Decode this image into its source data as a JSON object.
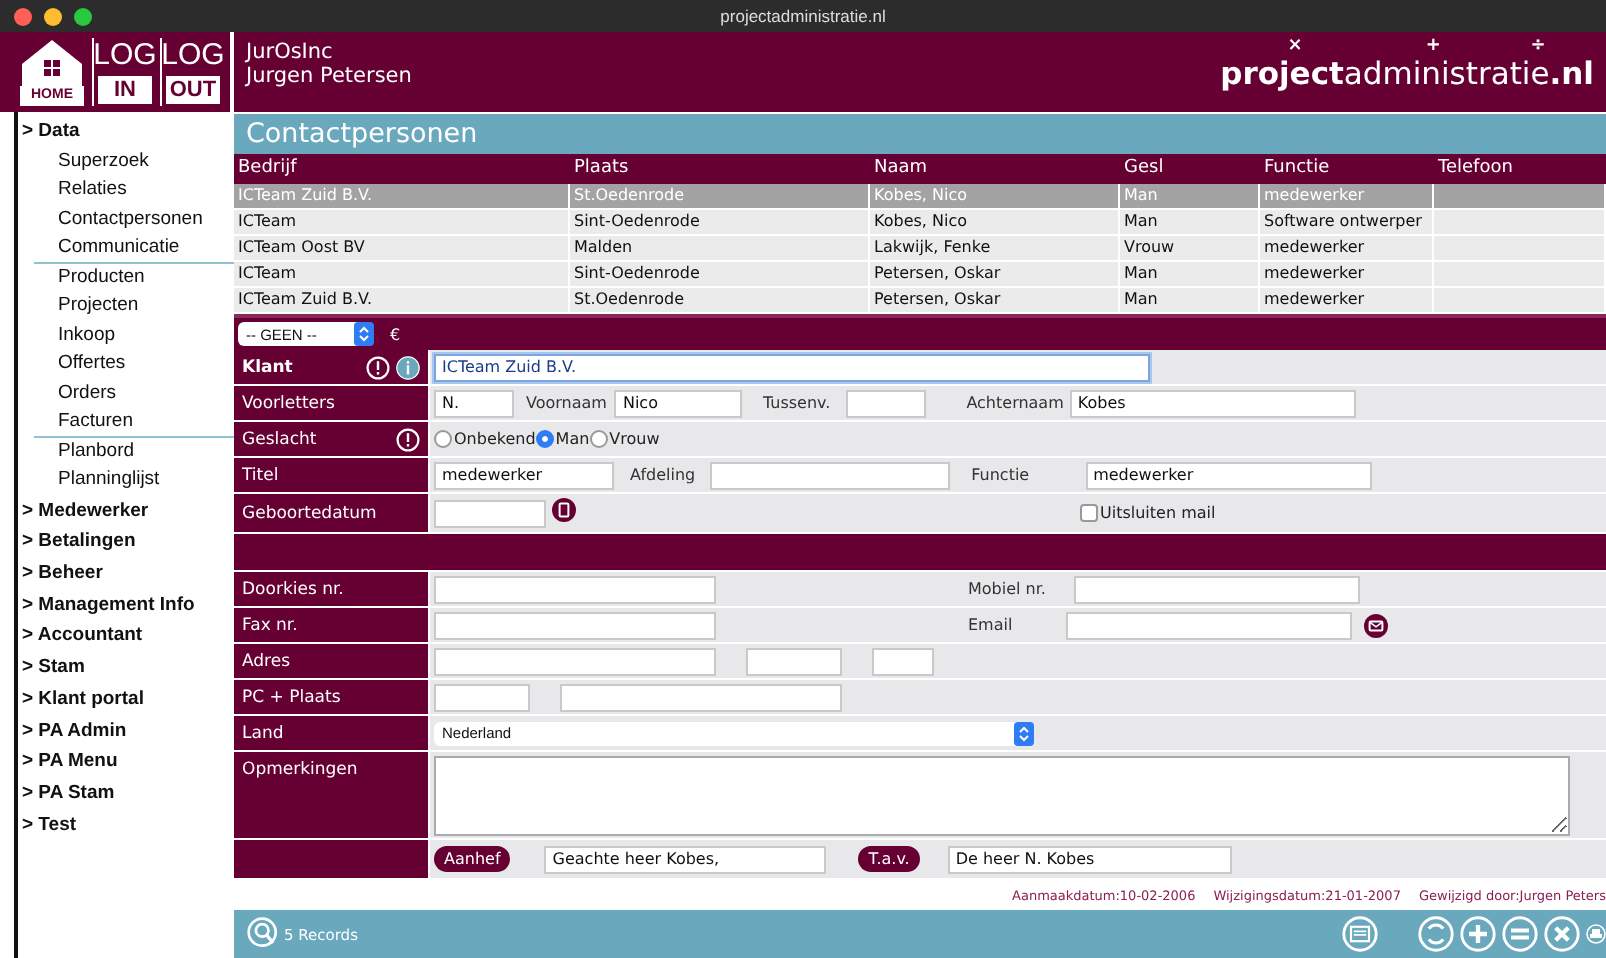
{
  "window": {
    "title": "projectadministratie.nl"
  },
  "header": {
    "buttons": [
      {
        "kind": "home",
        "label": "HOME"
      },
      {
        "kind": "log",
        "top": "LOG",
        "bottom": "IN"
      },
      {
        "kind": "log",
        "top": "LOG",
        "bottom": "OUT"
      }
    ],
    "company": "JurOsInc",
    "user": "Jurgen Petersen",
    "logo": {
      "text": "**project**administratie**.nl**",
      "marks": [
        "×",
        "+",
        "÷"
      ]
    }
  },
  "sidebar": {
    "sections": [
      {
        "label": "> Data",
        "children": [
          {
            "label": "Superzoek",
            "divider": false
          },
          {
            "label": "Relaties",
            "divider": false
          },
          {
            "label": "Contactpersonen",
            "divider": false
          },
          {
            "label": "Communicatie",
            "divider": true
          },
          {
            "label": "Producten",
            "divider": false
          },
          {
            "label": "Projecten",
            "divider": false
          },
          {
            "label": "Inkoop",
            "divider": false
          },
          {
            "label": "Offertes",
            "divider": false
          },
          {
            "label": "Orders",
            "divider": false
          },
          {
            "label": "Facturen",
            "divider": true
          },
          {
            "label": "Planbord",
            "divider": false
          },
          {
            "label": "Planninglijst",
            "divider": false
          }
        ]
      },
      {
        "label": "> Medewerker"
      },
      {
        "label": "> Betalingen"
      },
      {
        "label": "> Beheer"
      },
      {
        "label": "> Management Info"
      },
      {
        "label": "> Accountant"
      },
      {
        "label": "> Stam"
      },
      {
        "label": "> Klant portal"
      },
      {
        "label": "> PA Admin"
      },
      {
        "label": "> PA Menu"
      },
      {
        "label": "> PA Stam"
      },
      {
        "label": "> Test"
      }
    ]
  },
  "page_title": "Contactpersonen",
  "table": {
    "columns": [
      "Bedrijf",
      "Plaats",
      "Naam",
      "Gesl",
      "Functie",
      "Telefoon"
    ],
    "rows": [
      {
        "selected": true,
        "cells": [
          "ICTeam Zuid B.V.",
          "St.Oedenrode",
          "Kobes, Nico",
          "Man",
          "medewerker"
        ]
      },
      {
        "selected": false,
        "cells": [
          "ICTeam",
          "Sint-Oedenrode",
          "Kobes, Nico",
          "Man",
          "Software ontwerper"
        ]
      },
      {
        "selected": false,
        "cells": [
          "ICTeam Oost BV",
          "Malden",
          "Lakwijk, Fenke",
          "Vrouw",
          "medewerker"
        ]
      },
      {
        "selected": false,
        "cells": [
          "ICTeam",
          "Sint-Oedenrode",
          "Petersen, Oskar",
          "Man",
          "medewerker"
        ]
      },
      {
        "selected": false,
        "cells": [
          "ICTeam Zuid B.V.",
          "St.Oedenrode",
          "Petersen, Oskar",
          "Man",
          "medewerker"
        ]
      }
    ]
  },
  "filter": {
    "value": "-- GEEN --",
    "currency": "€"
  },
  "form": {
    "rows": [
      {
        "kind": "company",
        "label": "Klant",
        "required": true,
        "value": "ICTeam Zuid B.V."
      },
      {
        "kind": "name",
        "label": "Voorletters",
        "required": false,
        "initials": "N.",
        "first_name_label": "Voornaam",
        "first_name": "Nico",
        "infix_label": "Tussenv.",
        "last_name_label": "Achternaam",
        "last_name": "Kobes"
      },
      {
        "kind": "gender",
        "label": "Geslacht",
        "required": true,
        "options": [
          {
            "label": "Onbekend",
            "selected": false
          },
          {
            "label": "Man",
            "selected": true
          },
          {
            "label": "Vrouw",
            "selected": false
          }
        ]
      },
      {
        "kind": "title",
        "label": "Titel",
        "required": false,
        "value": "medewerker",
        "department_label": "Afdeling",
        "function_label": "Functie",
        "function": "medewerker"
      },
      {
        "kind": "birthdate",
        "label": "Geboortedatum",
        "required": false,
        "mail_opt_out": {
          "label": "Uitsluiten mail",
          "checked": false
        }
      },
      {
        "kind": "band"
      },
      {
        "kind": "phone",
        "label": "Doorkies nr.",
        "required": false,
        "mobile_label": "Mobiel nr."
      },
      {
        "kind": "fax",
        "label": "Fax nr.",
        "required": false,
        "email_label": "Email"
      },
      {
        "kind": "address",
        "label": "Adres",
        "required": false
      },
      {
        "kind": "postcode",
        "label": "PC + Plaats",
        "required": false
      },
      {
        "kind": "country",
        "label": "Land",
        "required": false,
        "value": "Nederland"
      },
      {
        "kind": "notes",
        "label": "Opmerkingen",
        "required": false
      },
      {
        "kind": "salutation",
        "salutation_button": "Aanhef",
        "salutation": "Geachte heer Kobes,",
        "attention_button": "T.a.v.",
        "attention": "De heer N. Kobes"
      }
    ]
  },
  "meta": [
    "Aanmaakdatum:10-02-2006",
    "Wijzigingsdatum:21-01-2007",
    "Gewijzigd door:Jurgen Peters"
  ],
  "footer": {
    "records": "5 Records"
  }
}
